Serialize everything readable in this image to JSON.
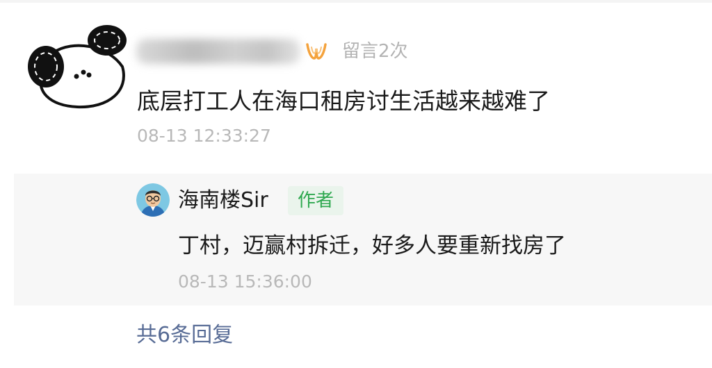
{
  "comment": {
    "avatar_icon": "panda-doodle-icon",
    "username_blurred": true,
    "badge_icon": "orange-w-badge-icon",
    "badge_color": "#f4a23c",
    "visit_count": "留言2次",
    "text": "底层打工人在海口租房讨生活越来越难了",
    "time": "08-13 12:33:27"
  },
  "reply": {
    "avatar_icon": "cartoon-man-avatar-icon",
    "name": "海南楼Sir",
    "author_tag": "作者",
    "author_tag_color": "#2ea84f",
    "text": "丁村，迈赢村拆迁，好多人要重新找房了",
    "time": "08-13 15:36:00"
  },
  "footer": {
    "more_replies": "共6条回复",
    "link_color": "#576b95"
  }
}
